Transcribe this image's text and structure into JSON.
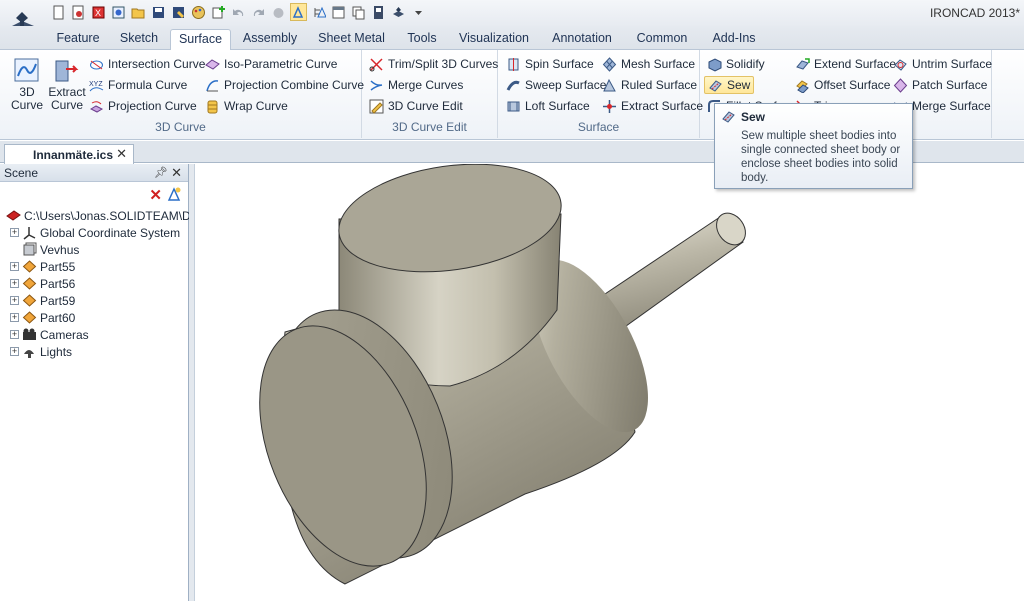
{
  "app": {
    "title": "IRONCAD 2013*"
  },
  "tabs": [
    {
      "label": "Feature",
      "active": false
    },
    {
      "label": "Sketch",
      "active": false
    },
    {
      "label": "Surface",
      "active": true
    },
    {
      "label": "Assembly",
      "active": false
    },
    {
      "label": "Sheet Metal",
      "active": false
    },
    {
      "label": "Tools",
      "active": false
    },
    {
      "label": "Visualization",
      "active": false
    },
    {
      "label": "Annotation",
      "active": false
    },
    {
      "label": "Common",
      "active": false
    },
    {
      "label": "Add-Ins",
      "active": false
    }
  ],
  "ribbon": {
    "curve3d": {
      "label": "3D Curve",
      "big": [
        "3D Curve",
        "Extract Curve"
      ],
      "items": [
        "Intersection Curve",
        "Formula Curve",
        "Projection Curve",
        "Iso-Parametric Curve",
        "Projection Combine Curve",
        "Wrap Curve"
      ]
    },
    "curveEdit": {
      "label": "3D Curve Edit",
      "items": [
        "Trim/Split 3D Curves",
        "Merge Curves",
        "3D Curve Edit"
      ]
    },
    "surface": {
      "label": "Surface",
      "items": [
        "Spin Surface",
        "Sweep Surface",
        "Loft Surface",
        "Mesh Surface",
        "Ruled Surface",
        "Extract Surface"
      ]
    },
    "surfaceEdit": {
      "items": [
        "Solidify",
        "Sew",
        "Fillet Surface",
        "Trim",
        "Extend Surface",
        "Offset Surface",
        "Untrim Surface",
        "Patch Surface",
        "Merge Surface"
      ]
    }
  },
  "tooltip": {
    "title": "Sew",
    "body": "Sew multiple sheet bodies into single connected sheet body or enclose sheet bodies into solid body."
  },
  "document": {
    "tab_name": "Innanmäte.ics"
  },
  "scene": {
    "title": "Scene",
    "tree": [
      {
        "label": "C:\\Users\\Jonas.SOLIDTEAM\\Des",
        "icon": "scene-root-icon"
      },
      {
        "label": "Global Coordinate System",
        "icon": "coordinate-system-icon"
      },
      {
        "label": "Vevhus",
        "icon": "part-gray-icon"
      },
      {
        "label": "Part55",
        "icon": "part-icon"
      },
      {
        "label": "Part56",
        "icon": "part-icon"
      },
      {
        "label": "Part59",
        "icon": "part-icon"
      },
      {
        "label": "Part60",
        "icon": "part-icon"
      },
      {
        "label": "Cameras",
        "icon": "camera-icon"
      },
      {
        "label": "Lights",
        "icon": "light-icon"
      }
    ]
  },
  "colors": {
    "accent": "#2b6fc7",
    "model": "#a8a596",
    "ribbon_highlight": "#ffe79a"
  }
}
